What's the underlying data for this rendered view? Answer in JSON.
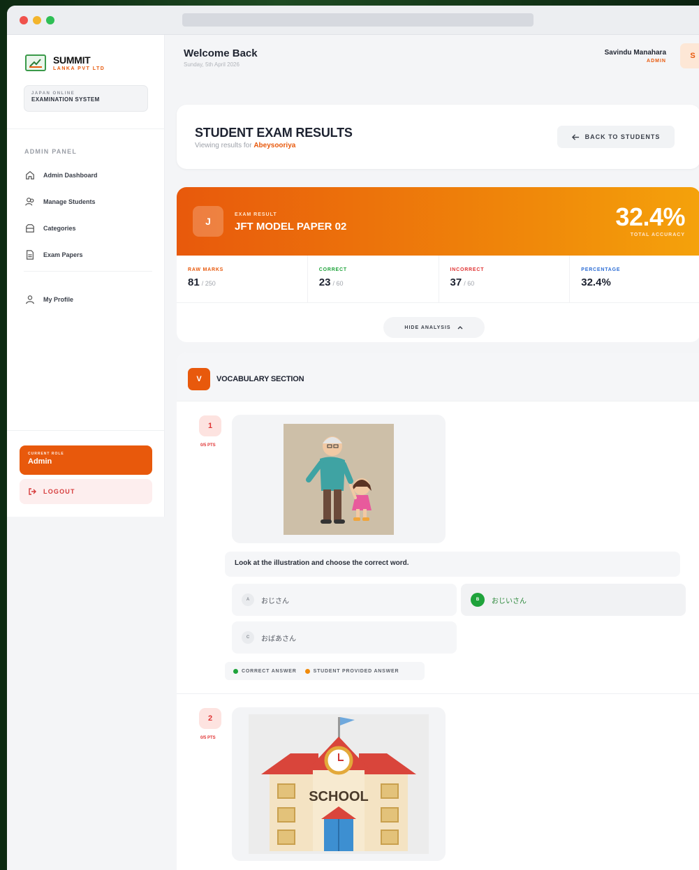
{
  "brand": {
    "name": "SUMMIT",
    "sub": "LANKA PVT LTD",
    "system_line1": "JAPAN ONLINE",
    "system_line2": "EXAMINATION SYSTEM"
  },
  "sidebar": {
    "panel_label": "ADMIN PANEL",
    "items": [
      {
        "label": "Admin Dashboard",
        "icon": "home-icon"
      },
      {
        "label": "Manage Students",
        "icon": "users-icon"
      },
      {
        "label": "Categories",
        "icon": "folder-icon"
      },
      {
        "label": "Exam Papers",
        "icon": "document-icon"
      }
    ],
    "profile": {
      "label": "My Profile",
      "icon": "user-icon"
    },
    "role_label": "CURRENT ROLE",
    "role_value": "Admin",
    "logout_label": "LOGOUT"
  },
  "header": {
    "welcome": "Welcome Back",
    "date": "Sunday, 5th April 2026",
    "user_name": "Savindu Manahara",
    "user_role": "ADMIN",
    "avatar_initial": "S"
  },
  "page": {
    "title": "STUDENT EXAM RESULTS",
    "subtitle_prefix": "Viewing results for",
    "student_name": "Abeysooriya",
    "back_button": "BACK TO STUDENTS"
  },
  "result": {
    "badge": "J",
    "label": "EXAM RESULT",
    "exam_name": "JFT MODEL PAPER 02",
    "accuracy": "32.4%",
    "accuracy_label": "TOTAL ACCURACY",
    "stats": [
      {
        "label": "RAW MARKS",
        "value": "81",
        "denominator": "/ 250",
        "color": "#e8590c"
      },
      {
        "label": "CORRECT",
        "value": "23",
        "denominator": "/ 60",
        "color": "#1fa33b"
      },
      {
        "label": "INCORRECT",
        "value": "37",
        "denominator": "/ 60",
        "color": "#e03434"
      },
      {
        "label": "PERCENTAGE",
        "value": "32.4%",
        "denominator": "",
        "color": "#2f6fd6"
      }
    ],
    "hide_analysis": "HIDE ANALYSIS"
  },
  "section": {
    "badge": "V",
    "title": "VOCABULARY SECTION"
  },
  "questions": [
    {
      "number": "1",
      "points": "0/5 PTS",
      "image": "grandfather-and-child-illustration",
      "text": "Look at the illustration and choose the correct word.",
      "options": [
        {
          "letter": "A",
          "text": "おじさん",
          "state": "normal"
        },
        {
          "letter": "B",
          "text": "おじいさん",
          "state": "correct"
        },
        {
          "letter": "C",
          "text": "おばあさん",
          "state": "normal"
        }
      ],
      "legend": {
        "correct": "CORRECT ANSWER",
        "student": "STUDENT PROVIDED ANSWER"
      }
    },
    {
      "number": "2",
      "points": "0/5 PTS",
      "image": "school-building-illustration",
      "image_text": "SCHOOL"
    }
  ],
  "colors": {
    "accent": "#e8590c",
    "correct": "#1fa33b",
    "incorrect": "#e03434",
    "percentage": "#2f6fd6",
    "student_answer": "#f08a0a"
  }
}
